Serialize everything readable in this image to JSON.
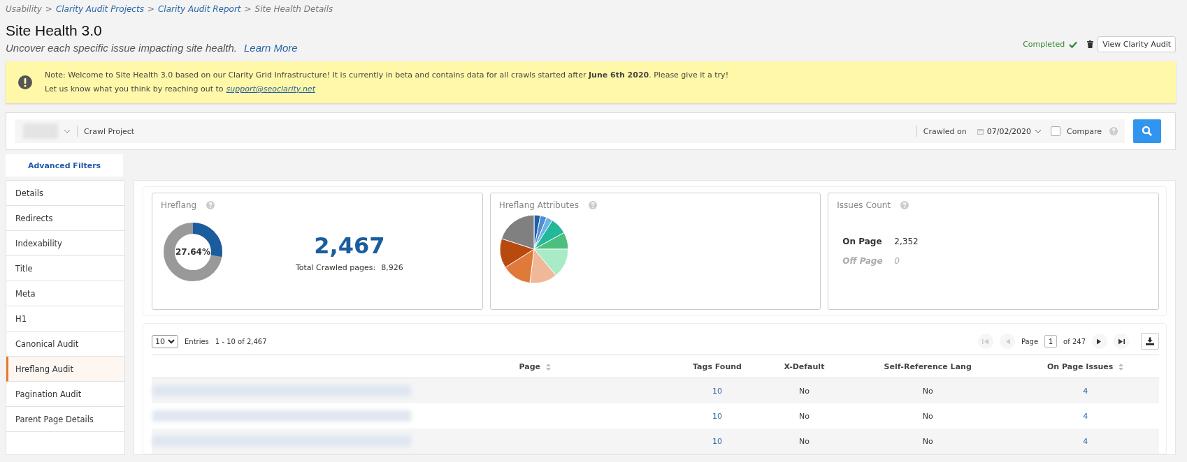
{
  "breadcrumb": [
    {
      "label": "Usability",
      "link": false
    },
    {
      "label": "Clarity Audit Projects",
      "link": true
    },
    {
      "label": "Clarity Audit Report",
      "link": true
    },
    {
      "label": "Site Health Details",
      "link": false
    }
  ],
  "breadcrumb_separator": ">",
  "title": "Site Health 3.0",
  "subtitle": "Uncover each specific issue impacting site health.",
  "learn_more": "Learn More",
  "status": "Completed",
  "view_button": "View Clarity Audit",
  "notice": {
    "text": "Note: Welcome to Site Health 3.0 based on our Clarity Grid Infrastructure! It is currently in beta and contains data for all crawls started after **June 6th 2020**. Please give it a try!",
    "text2": "Let us know what you think by reaching out to",
    "email": "support@seoclarity.net"
  },
  "filter": {
    "project_label": "Crawl Project",
    "crawled_on": "Crawled on",
    "date": "07/02/2020",
    "compare": "Compare",
    "compare_checked": false
  },
  "advanced_filters": "Advanced Filters",
  "sidebar": {
    "items": [
      {
        "label": "Details",
        "selected": false
      },
      {
        "label": "Redirects",
        "selected": false
      },
      {
        "label": "Indexability",
        "selected": false
      },
      {
        "label": "Title",
        "selected": false
      },
      {
        "label": "Meta",
        "selected": false
      },
      {
        "label": "H1",
        "selected": false
      },
      {
        "label": "Canonical Audit",
        "selected": false
      },
      {
        "label": "Hreflang Audit",
        "selected": true
      },
      {
        "label": "Pagination Audit",
        "selected": false
      },
      {
        "label": "Parent Page Details",
        "selected": false
      }
    ]
  },
  "cards": {
    "hreflang": {
      "title": "Hreflang",
      "level": 0.2764,
      "reading": "27.64%",
      "big": "2,467",
      "total_label": "Total Crawled pages:",
      "total": "8,926"
    },
    "attributes": {
      "title": "Hreflang Attributes"
    },
    "issues": {
      "title": "Issues Count",
      "rows": [
        {
          "label": "On Page",
          "value": "2,352",
          "disabled": false
        },
        {
          "label": "Off Page",
          "value": "0",
          "disabled": true
        }
      ]
    }
  },
  "table": {
    "page_size": "10",
    "entries_label": "Entries",
    "range": "1 - 10 of 2,467",
    "pager": {
      "page_label": "Page",
      "page": "1",
      "of": "of 247",
      "buttons": [
        {
          "kind": "first",
          "disabled": true
        },
        {
          "kind": "prev",
          "disabled": true
        },
        {
          "kind": "next",
          "disabled": false
        },
        {
          "kind": "last",
          "disabled": false
        }
      ]
    },
    "columns": [
      {
        "label": "Page",
        "sortable": true
      },
      {
        "label": "Tags Found",
        "sortable": false
      },
      {
        "label": "X-Default",
        "sortable": false
      },
      {
        "label": "Self-Reference Lang",
        "sortable": false
      },
      {
        "label": "On Page Issues",
        "sortable": true
      }
    ],
    "rows": [
      {
        "tags_found": "10",
        "x_default": "No",
        "self_reference_lang": "No",
        "on_page_issues": "4"
      },
      {
        "tags_found": "10",
        "x_default": "No",
        "self_reference_lang": "No",
        "on_page_issues": "4"
      },
      {
        "tags_found": "10",
        "x_default": "No",
        "self_reference_lang": "No",
        "on_page_issues": "4"
      }
    ]
  }
}
